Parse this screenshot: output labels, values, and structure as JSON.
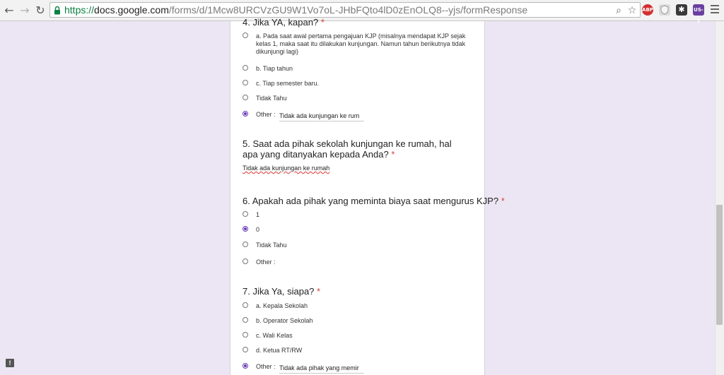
{
  "browser": {
    "url_scheme": "https://",
    "url_host": "docs.google.com",
    "url_path": "/forms/d/1Mcw8URCVzGU9W1Vo7oL-JHbFQto4lD0zEnOLQ8--yjs/formResponse",
    "extensions": [
      {
        "name": "adblock-icon",
        "label": "ABP",
        "color": "#d32f2f"
      },
      {
        "name": "shield-extension-icon",
        "label": "",
        "color": "#cfcfcf"
      },
      {
        "name": "puzzle-extension-icon",
        "label": "",
        "color": "#3a3a3a"
      },
      {
        "name": "us-extension-icon",
        "label": "US-1",
        "color": "#6a3fa0"
      }
    ]
  },
  "colors": {
    "accent": "#673ab7",
    "required": "#db4437",
    "background": "#ece6f4"
  },
  "questions": [
    {
      "title": "4. Jika YA, kapan?",
      "required": "*",
      "options": [
        {
          "label": "a. Pada saat awal pertama pengajuan KJP (misalnya mendapat KJP sejak kelas 1, maka saat itu dilakukan kunjungan. Namun tahun berikutnya tidak dikunjungi lagi)",
          "checked": false
        },
        {
          "label": "b. Tiap tahun",
          "checked": false
        },
        {
          "label": "c. Tiap semester baru.",
          "checked": false
        },
        {
          "label": "Tidak Tahu",
          "checked": false
        },
        {
          "label": "Other :",
          "checked": true,
          "other_value": "Tidak ada kunjungan ke rum"
        }
      ]
    },
    {
      "title": "5. Saat ada pihak sekolah kunjungan ke rumah, hal apa yang ditanyakan kepada Anda?",
      "required": "*",
      "answer": "Tidak ada kunjungan ke rumah"
    },
    {
      "title": "6. Apakah ada pihak yang meminta biaya saat mengurus KJP?",
      "required": "*",
      "options": [
        {
          "label": "1",
          "checked": false
        },
        {
          "label": "0",
          "checked": true
        },
        {
          "label": "Tidak Tahu",
          "checked": false
        },
        {
          "label": "Other :",
          "checked": false,
          "other_value": ""
        }
      ]
    },
    {
      "title": "7. Jika Ya, siapa?",
      "required": "*",
      "options": [
        {
          "label": "a. Kepala Sekolah",
          "checked": false
        },
        {
          "label": "b. Operator Sekolah",
          "checked": false
        },
        {
          "label": "c. Wali Kelas",
          "checked": false
        },
        {
          "label": "d. Ketua RT/RW",
          "checked": false
        },
        {
          "label": "Other :",
          "checked": true,
          "other_value": "Tidak ada pihak yang memir"
        }
      ]
    }
  ]
}
